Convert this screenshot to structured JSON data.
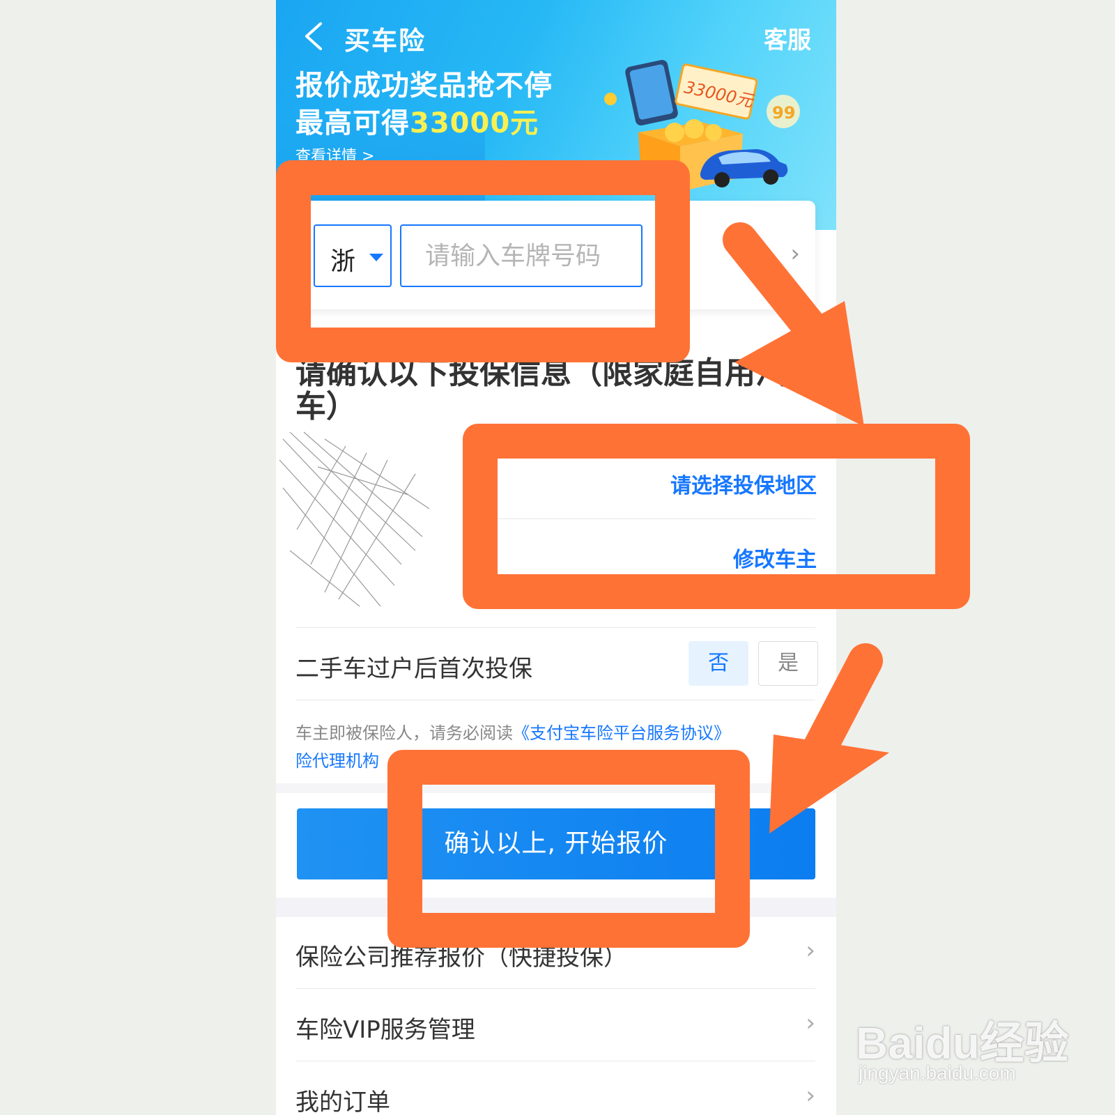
{
  "nav": {
    "title": "买车险",
    "service": "客服"
  },
  "banner": {
    "line1": "报价成功奖品抢不停",
    "line2_prefix": "最高可得",
    "line2_amount": "33000元",
    "details": "查看详情 >",
    "ticket": "33000元",
    "badge": "99"
  },
  "plate": {
    "province": "浙",
    "placeholder": "请输入车牌号码",
    "chevron": "›"
  },
  "section": {
    "title": "请确认以下投保信息（限家庭自用汽车）"
  },
  "links": {
    "region": "请选择投保地区",
    "owner": "修改车主"
  },
  "used_car": {
    "label": "二手车过户后首次投保",
    "no": "否",
    "yes": "是"
  },
  "agreement": {
    "prefix": "车主即被保险人，请务必阅读",
    "link": "《支付宝车险平台服务协议》",
    "line2": "险代理机构"
  },
  "cta": {
    "label": "确认以上, 开始报价"
  },
  "list": [
    {
      "label": "保险公司推荐报价（快捷投保）",
      "chevron": "›"
    },
    {
      "label": "车险VIP服务管理",
      "chevron": "›"
    },
    {
      "label": "我的订单",
      "chevron": "›"
    }
  ],
  "annotation_color": "#ff7236",
  "watermark": {
    "logo": "Baidu经验",
    "url": "jingyan.baidu.com"
  }
}
